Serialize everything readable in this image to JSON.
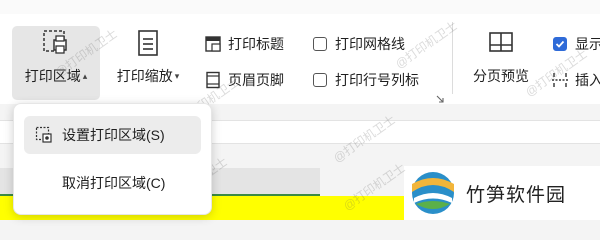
{
  "ribbon": {
    "print_area": {
      "label": "打印区域"
    },
    "print_scale": {
      "label": "打印缩放"
    },
    "print_titles": {
      "label": "打印标题"
    },
    "header_footer": {
      "label": "页眉页脚"
    },
    "print_gridlines": {
      "label": "打印网格线",
      "checked": false
    },
    "print_row_col": {
      "label": "打印行号列标",
      "checked": false
    },
    "page_break_preview": {
      "label": "分页预览"
    },
    "show": {
      "label": "显示",
      "checked": true
    },
    "insert": {
      "label": "插入"
    }
  },
  "dropdown": {
    "items": [
      {
        "label": "设置打印区域(S)"
      },
      {
        "label": "取消打印区域(C)"
      }
    ]
  },
  "logo": {
    "text": "竹笋软件园"
  },
  "watermark": {
    "text": "@打印机卫士"
  },
  "colors": {
    "accent": "#2f6bd8",
    "highlight_yellow": "#ffff00",
    "row_gray": "#e4e4e4",
    "selection_green": "#3b8a44"
  }
}
